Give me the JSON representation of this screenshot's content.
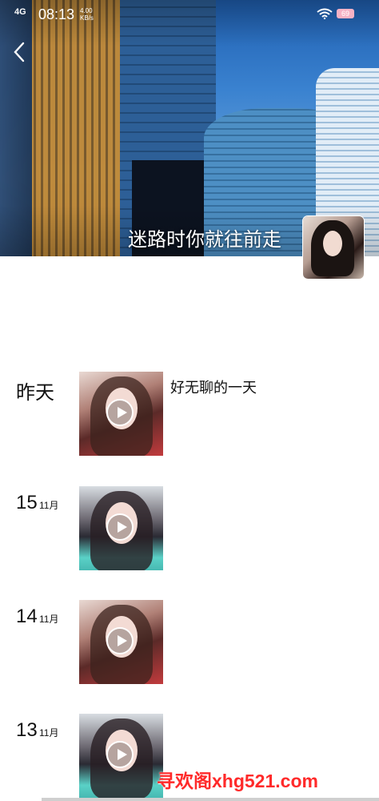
{
  "status_bar": {
    "network": "4G",
    "time": "08:13",
    "speed_value": "4.00",
    "speed_unit": "KB/s",
    "battery": "69"
  },
  "cover": {
    "title": "迷路时你就往前走"
  },
  "feed": [
    {
      "date_label": "昨天",
      "day": "",
      "month": "",
      "caption": "好无聊的一天",
      "thumb_style": "red"
    },
    {
      "date_label": "",
      "day": "15",
      "month": "11月",
      "caption": "",
      "thumb_style": "teal"
    },
    {
      "date_label": "",
      "day": "14",
      "month": "11月",
      "caption": "",
      "thumb_style": "red"
    },
    {
      "date_label": "",
      "day": "13",
      "month": "11月",
      "caption": "",
      "thumb_style": "teal"
    }
  ],
  "watermark": "寻欢阁xhg521.com",
  "icons": {
    "back": "chevron-left-icon",
    "play": "play-icon",
    "wifi": "wifi-icon",
    "signal": "signal-icon"
  },
  "colors": {
    "watermark": "#ff2a2a",
    "battery": "#f6b2c5"
  }
}
